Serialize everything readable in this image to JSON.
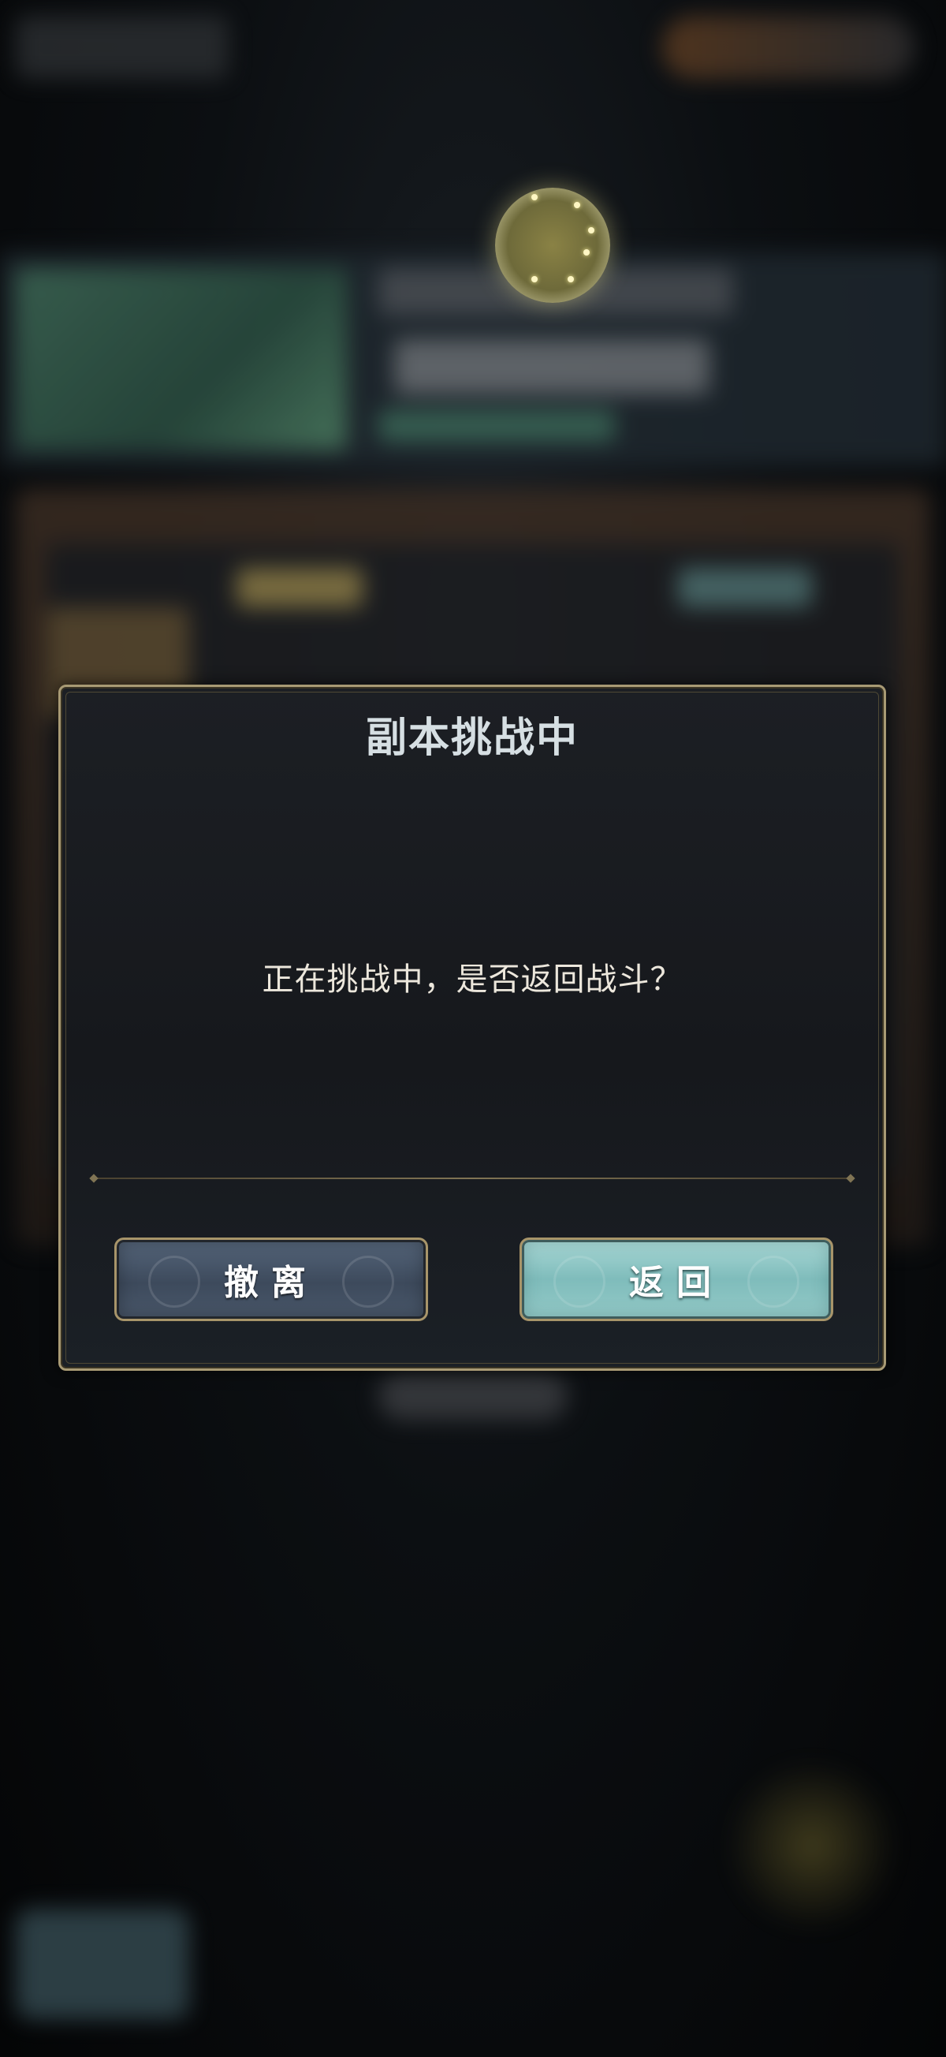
{
  "dialog": {
    "title": "副本挑战中",
    "message": "正在挑战中，是否返回战斗？",
    "cancel_label": "撤离",
    "confirm_label": "返回"
  },
  "colors": {
    "dialog_border": "#a89a74",
    "dialog_bg": "#1c1f24",
    "title_text": "#d6dfe3",
    "message_text": "#ece7dc",
    "cancel_button": "#4a586b",
    "confirm_button": "#94cac8",
    "loading_orb": "#8a8245"
  },
  "icons": {
    "loading": "loading-orb-icon"
  }
}
